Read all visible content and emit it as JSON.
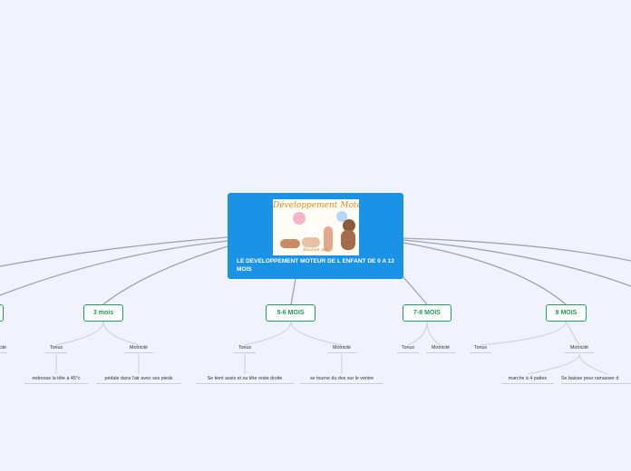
{
  "root": {
    "title": "LE DEVELOPPEMENT MOTEUR DE L ENFANT DE 0 A 12 MOIS",
    "image_text": "Développement Moteur",
    "image_subtext": "Réalisé par"
  },
  "topics": [
    {
      "label": "",
      "children": [
        "Motricité"
      ]
    },
    {
      "label": "3 mois",
      "children": [
        "Tonus",
        "Motricité"
      ]
    },
    {
      "label": "5-6 MOIS",
      "children": [
        "Tonus",
        "Motricité"
      ]
    },
    {
      "label": "7-8 MOIS",
      "children": [
        "Tonus",
        "Motricité"
      ]
    },
    {
      "label": "9 MOIS",
      "children": [
        "Tonus",
        "Motricité"
      ]
    }
  ],
  "leaves": {
    "m3_tonus": "redresse la tête à 45°c",
    "m3_motricite": "pédale dans l'air avec ses pieds",
    "m56_tonus": "Se tient assis et sa tête reste droite",
    "m56_motricite": "se tourne du dos sur le ventre",
    "m9_motricite_1": "marche à 4 pattes",
    "m9_motricite_2": "Se baisse pour ramasser d"
  },
  "colors": {
    "background": "#f0f3fb",
    "root": "#1a93e6",
    "topic_border": "#22a05a",
    "topic_text": "#1d9a52",
    "root_link": "#9aa3b3",
    "sub_link": "#c8cedb"
  }
}
